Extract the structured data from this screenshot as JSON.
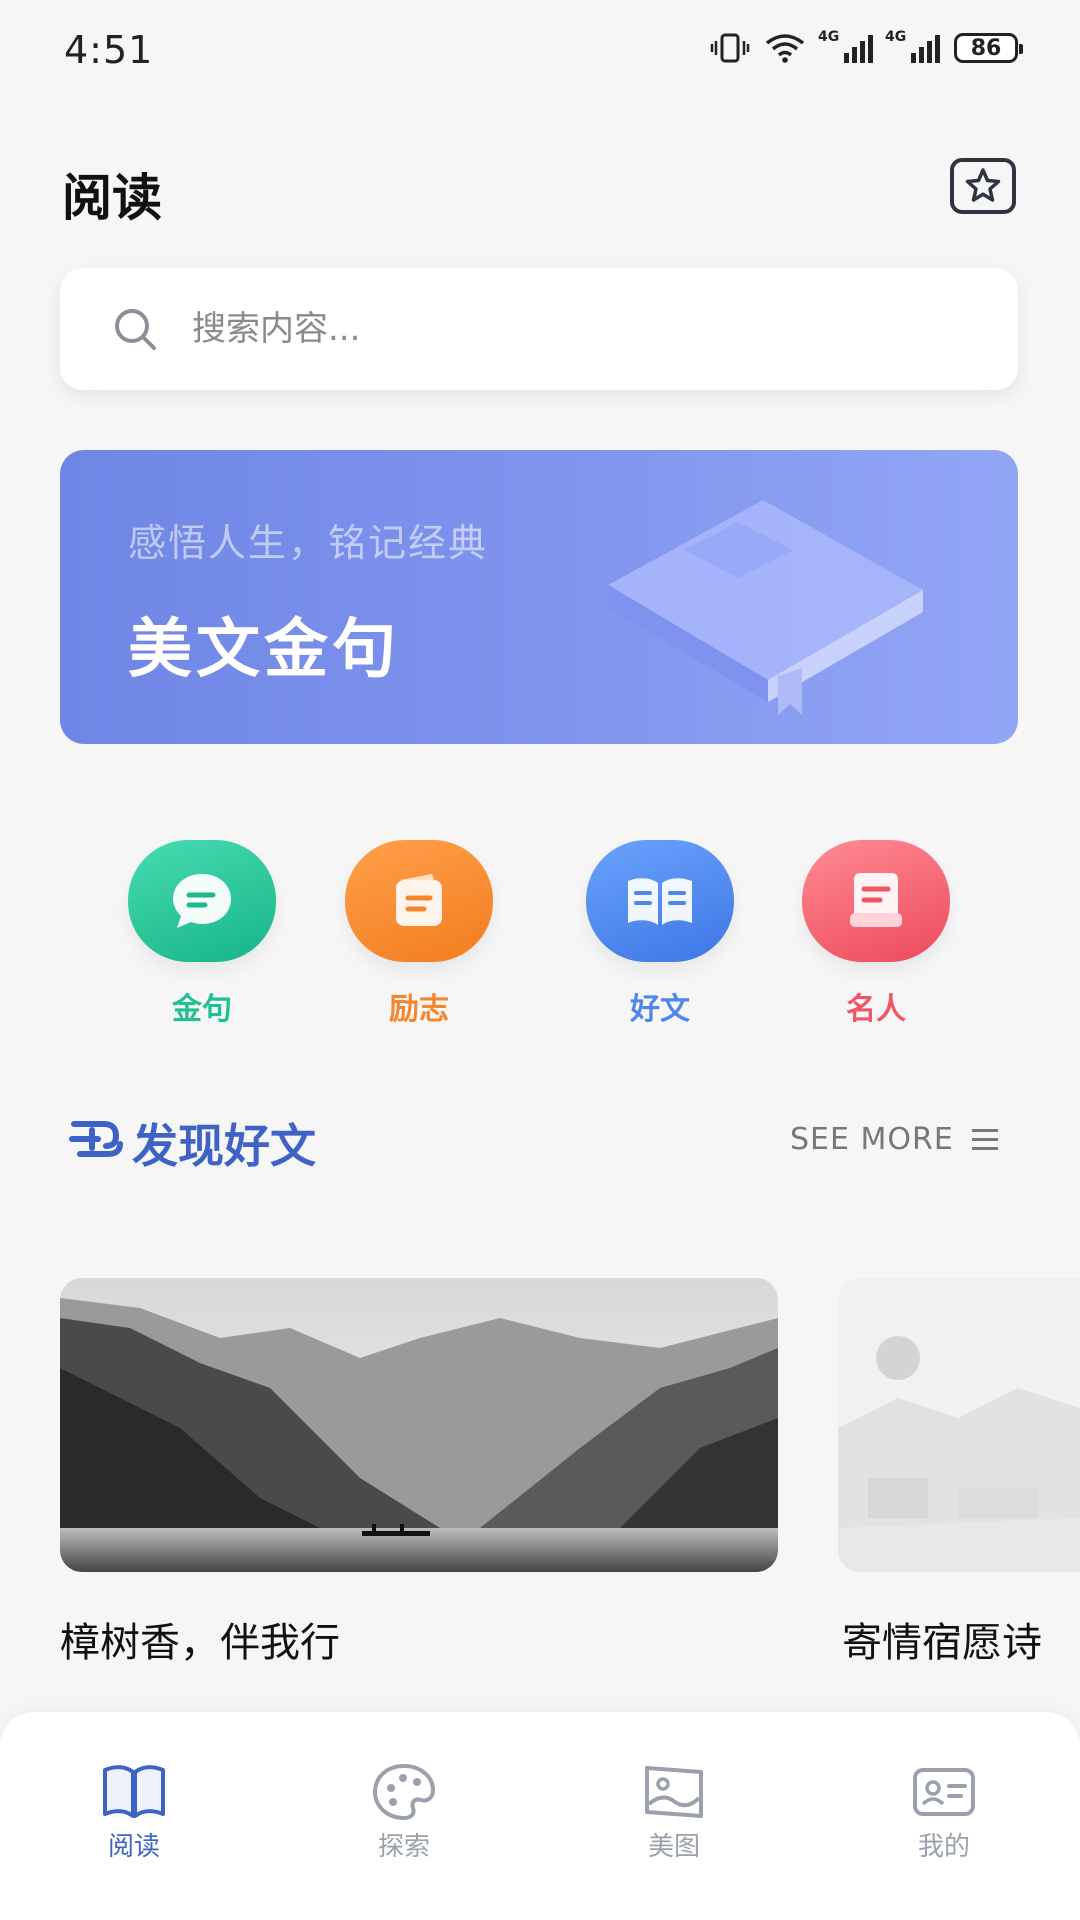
{
  "status_bar": {
    "time": "4:51",
    "battery": "86",
    "network_tag_1": "4G",
    "network_tag_2": "4G"
  },
  "header": {
    "title": "阅读",
    "favorite_icon": "star-icon"
  },
  "search": {
    "placeholder": "搜索内容..."
  },
  "banner": {
    "subtitle": "感悟人生，铭记经典",
    "title": "美文金句"
  },
  "categories": [
    {
      "label": "金句",
      "icon": "chat-bubble-icon",
      "color": "#22bf92"
    },
    {
      "label": "励志",
      "icon": "notebook-icon",
      "color": "#f4872d"
    },
    {
      "label": "好文",
      "icon": "open-book-icon",
      "color": "#4d86ec"
    },
    {
      "label": "名人",
      "icon": "document-icon",
      "color": "#ef5666"
    }
  ],
  "section": {
    "title": "发现好文",
    "see_more": "SEE MORE"
  },
  "articles": [
    {
      "title": "樟树香，伴我行"
    },
    {
      "title": "寄情宿愿诗"
    }
  ],
  "tabs": [
    {
      "label": "阅读",
      "icon": "book-icon",
      "active": true
    },
    {
      "label": "探索",
      "icon": "palette-icon",
      "active": false
    },
    {
      "label": "美图",
      "icon": "image-icon",
      "active": false
    },
    {
      "label": "我的",
      "icon": "id-card-icon",
      "active": false
    }
  ],
  "colors": {
    "accent": "#3f62c6",
    "banner": "#7b8fec",
    "tab_inactive": "#9aa1ad"
  }
}
